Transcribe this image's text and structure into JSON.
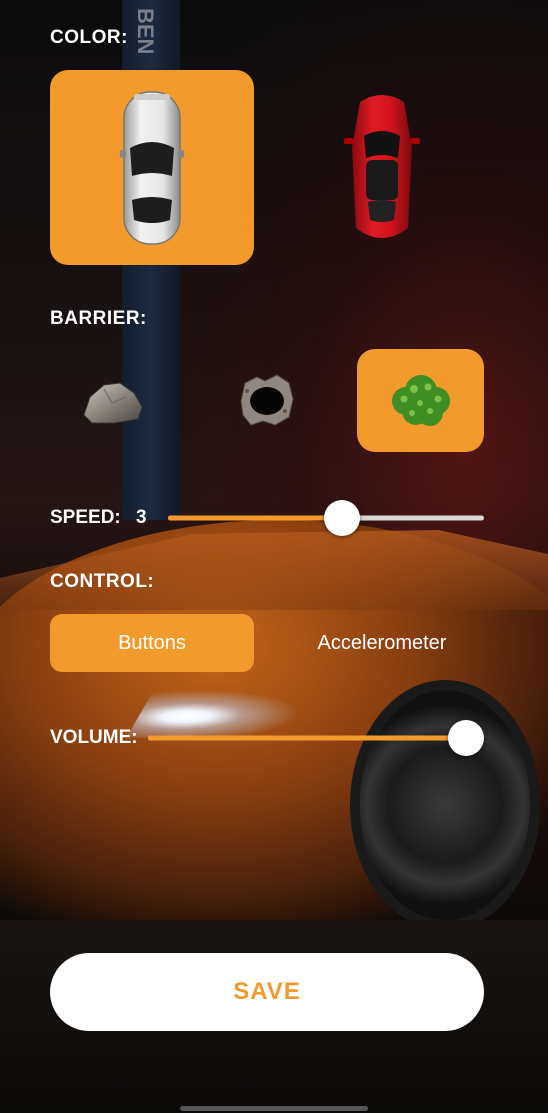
{
  "color": {
    "label": "COLOR:",
    "options": [
      {
        "name": "silver car",
        "selected": true
      },
      {
        "name": "red car",
        "selected": false
      }
    ]
  },
  "barrier": {
    "label": "BARRIER:",
    "options": [
      {
        "name": "rock",
        "selected": false
      },
      {
        "name": "hole",
        "selected": false
      },
      {
        "name": "bush",
        "selected": true
      }
    ]
  },
  "speed": {
    "label": "SPEED:",
    "value": "3",
    "fraction": 0.55
  },
  "control": {
    "label": "CONTROL:",
    "options": [
      {
        "label": "Buttons",
        "selected": true
      },
      {
        "label": "Accelerometer",
        "selected": false
      }
    ]
  },
  "volume": {
    "label": "VOLUME:",
    "fraction": 1.0
  },
  "save_label": "SAVE",
  "background_sign": "BEN",
  "colors": {
    "accent": "#f39a2c",
    "save_text": "#f39a2c",
    "track": "#d8d8d8",
    "thumb": "#ffffff"
  }
}
